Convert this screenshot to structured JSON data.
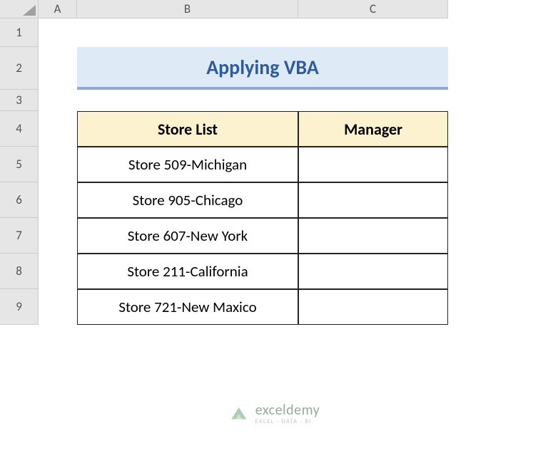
{
  "columns": [
    "A",
    "B",
    "C"
  ],
  "rows": [
    "1",
    "2",
    "3",
    "4",
    "5",
    "6",
    "7",
    "8",
    "9"
  ],
  "title": "Applying VBA",
  "table": {
    "headers": {
      "b": "Store List",
      "c": "Manager"
    },
    "data": [
      {
        "b": "Store 509-Michigan",
        "c": ""
      },
      {
        "b": "Store 905-Chicago",
        "c": ""
      },
      {
        "b": "Store 607-New York",
        "c": ""
      },
      {
        "b": "Store 211-California",
        "c": ""
      },
      {
        "b": "Store 721-New Maxico",
        "c": ""
      }
    ]
  },
  "watermark": {
    "brand": "exceldemy",
    "tagline": "EXCEL · DATA · BI"
  },
  "chart_data": {
    "type": "table",
    "title": "Applying VBA",
    "columns": [
      "Store List",
      "Manager"
    ],
    "rows": [
      [
        "Store 509-Michigan",
        ""
      ],
      [
        "Store 905-Chicago",
        ""
      ],
      [
        "Store 607-New York",
        ""
      ],
      [
        "Store 211-California",
        ""
      ],
      [
        "Store 721-New Maxico",
        ""
      ]
    ]
  }
}
